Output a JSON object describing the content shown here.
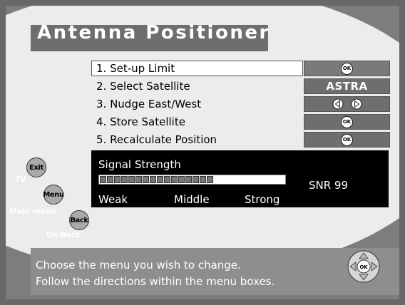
{
  "title": "Antenna Positioner",
  "menu": [
    {
      "label": "1. Set-up Limit",
      "action": "ok",
      "selected": true
    },
    {
      "label": "2. Select Satellite",
      "value": "ASTRA",
      "selected": false
    },
    {
      "label": "3. Nudge East/West",
      "action": "left-right-arrows",
      "selected": false
    },
    {
      "label": "4. Store Satellite",
      "action": "ok",
      "selected": false
    },
    {
      "label": "5. Recalculate Position",
      "action": "ok",
      "selected": false
    }
  ],
  "ok_label": "OK",
  "signal": {
    "title": "Signal Strength",
    "level_fraction": 0.63,
    "snr_label": "SNR 99",
    "scale": [
      "Weak",
      "Middle",
      "Strong"
    ]
  },
  "remote": {
    "exit": {
      "button": "Exit",
      "caption": "TV"
    },
    "menu": {
      "button": "Menu",
      "caption": "Main menu"
    },
    "back": {
      "button": "Back",
      "caption": "Go Back"
    }
  },
  "help": {
    "line1": "Choose the menu you wish to change.",
    "line2": "Follow the directions within the menu boxes."
  },
  "colors": {
    "frame": "#686868",
    "background": "#7d7d7d",
    "ellipse": "#ececec",
    "banner": "#6e6e6e",
    "signal_panel": "#000000"
  }
}
